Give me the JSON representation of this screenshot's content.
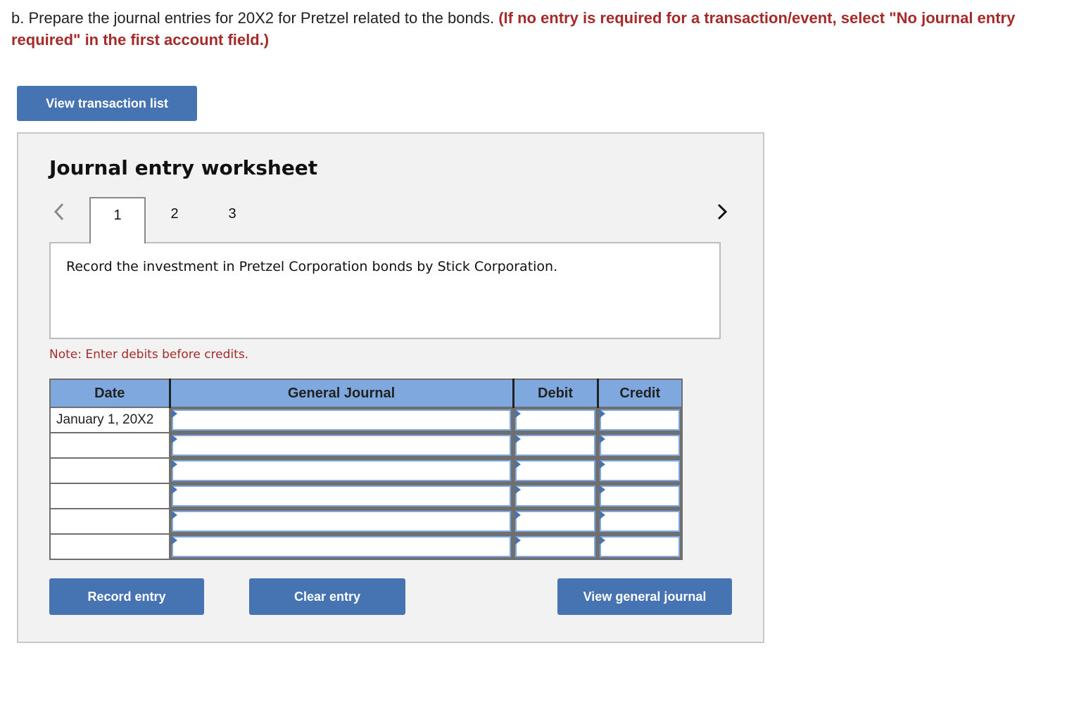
{
  "question": {
    "prefix": "b. Prepare the journal entries for 20X2 for Pretzel related to the bonds. ",
    "instruction": "(If no entry is required for a transaction/event, select \"No journal entry required\" in the first account field.)"
  },
  "buttons": {
    "view_transaction_list": "View transaction list",
    "record_entry": "Record entry",
    "clear_entry": "Clear entry",
    "view_general_journal": "View general journal"
  },
  "worksheet": {
    "title": "Journal entry worksheet",
    "tabs": [
      {
        "label": "1",
        "active": true
      },
      {
        "label": "2",
        "active": false
      },
      {
        "label": "3",
        "active": false
      }
    ],
    "prev_icon": "chevron-left-icon",
    "next_icon": "chevron-right-icon",
    "description": "Record the investment in Pretzel Corporation bonds by Stick Corporation.",
    "note": "Note: Enter debits before credits."
  },
  "table": {
    "headers": [
      "Date",
      "General Journal",
      "Debit",
      "Credit"
    ],
    "rows": [
      {
        "date": "January 1, 20X2",
        "account": "",
        "debit": "",
        "credit": ""
      },
      {
        "date": "",
        "account": "",
        "debit": "",
        "credit": ""
      },
      {
        "date": "",
        "account": "",
        "debit": "",
        "credit": ""
      },
      {
        "date": "",
        "account": "",
        "debit": "",
        "credit": ""
      },
      {
        "date": "",
        "account": "",
        "debit": "",
        "credit": ""
      },
      {
        "date": "",
        "account": "",
        "debit": "",
        "credit": ""
      }
    ]
  },
  "colors": {
    "accent_button": "#4673b1",
    "header_blue": "#7fa9de",
    "instruction_red": "#a52a2a",
    "panel_bg": "#f2f2f2"
  }
}
